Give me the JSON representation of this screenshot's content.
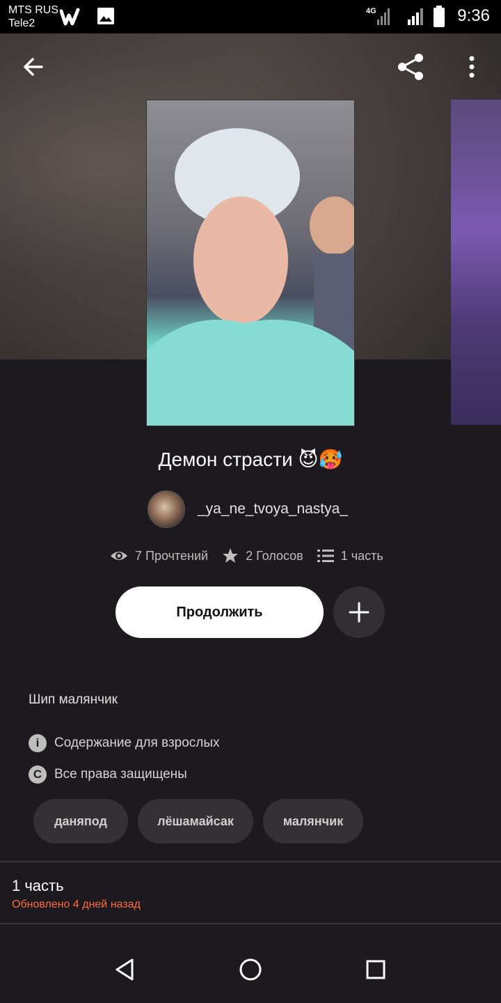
{
  "status_bar": {
    "carrier_1": "MTS RUS",
    "carrier_2": "Tele2",
    "network": "4G",
    "time": "9:36",
    "icons": [
      "wattpad-logo-icon",
      "image-icon",
      "signal-4g-icon",
      "signal-icon",
      "battery-icon"
    ]
  },
  "header": {
    "icons": [
      "back-arrow-icon",
      "share-icon",
      "more-vertical-icon"
    ]
  },
  "story": {
    "title": "Демон страсти 😈🥵",
    "author": "_ya_ne_tvoya_nastya_",
    "stats": {
      "reads": "7 Прочтений",
      "votes": "2 Голосов",
      "parts": "1 часть"
    },
    "continue_label": "Продолжить",
    "description": "Шип малянчик",
    "mature": "Содержание для взрослых",
    "copyright": "Все права защищены",
    "tags": [
      "даняпод",
      "лёшамайсак",
      "малянчик"
    ]
  },
  "parts_section": {
    "count_label": "1 часть",
    "updated": "Обновлено 4 дней назад"
  },
  "colors": {
    "background": "#1c1a1e",
    "accent_orange": "#ff6a3d",
    "button_white": "#ffffff",
    "chip_bg": "#343136"
  }
}
